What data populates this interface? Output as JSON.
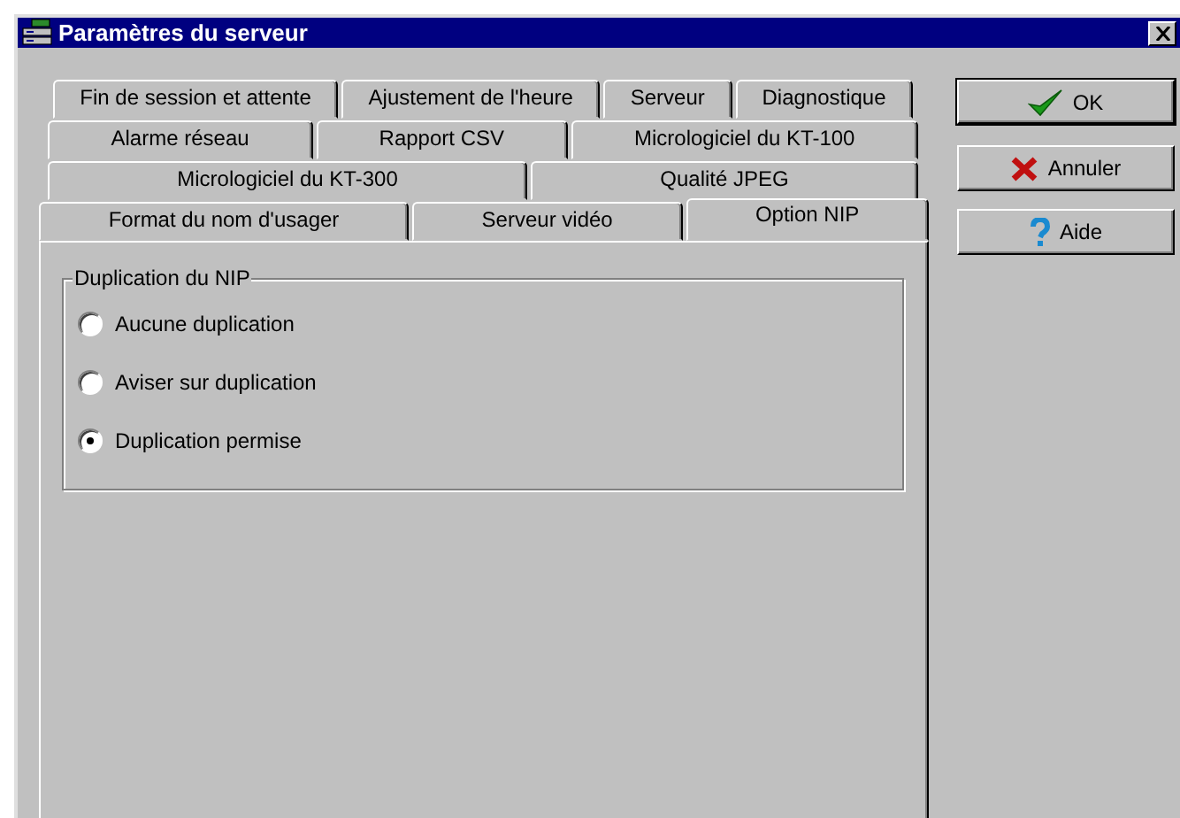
{
  "window": {
    "title": "Paramètres du serveur"
  },
  "tab_rows": [
    [
      {
        "label": "Fin de session et attente",
        "selected": false
      },
      {
        "label": "Ajustement de l'heure",
        "selected": false
      },
      {
        "label": "Serveur",
        "selected": false
      },
      {
        "label": "Diagnostique",
        "selected": false
      }
    ],
    [
      {
        "label": "Alarme réseau",
        "selected": false
      },
      {
        "label": "Rapport CSV",
        "selected": false
      },
      {
        "label": "Micrologiciel du KT-100",
        "selected": false
      }
    ],
    [
      {
        "label": "Micrologiciel du KT-300",
        "selected": false
      },
      {
        "label": "Qualité JPEG",
        "selected": false
      }
    ],
    [
      {
        "label": "Format du nom d'usager",
        "selected": false
      },
      {
        "label": "Serveur vidéo",
        "selected": false
      },
      {
        "label": "Option NIP",
        "selected": true
      }
    ]
  ],
  "group": {
    "title": "Duplication du NIP",
    "options": [
      {
        "label": "Aucune duplication",
        "selected": false
      },
      {
        "label": "Aviser sur duplication",
        "selected": false
      },
      {
        "label": "Duplication permise",
        "selected": true
      }
    ]
  },
  "buttons": [
    {
      "label": "OK",
      "kind": "ok"
    },
    {
      "label": "Annuler",
      "kind": "cancel"
    },
    {
      "label": "Aide",
      "kind": "help"
    }
  ]
}
